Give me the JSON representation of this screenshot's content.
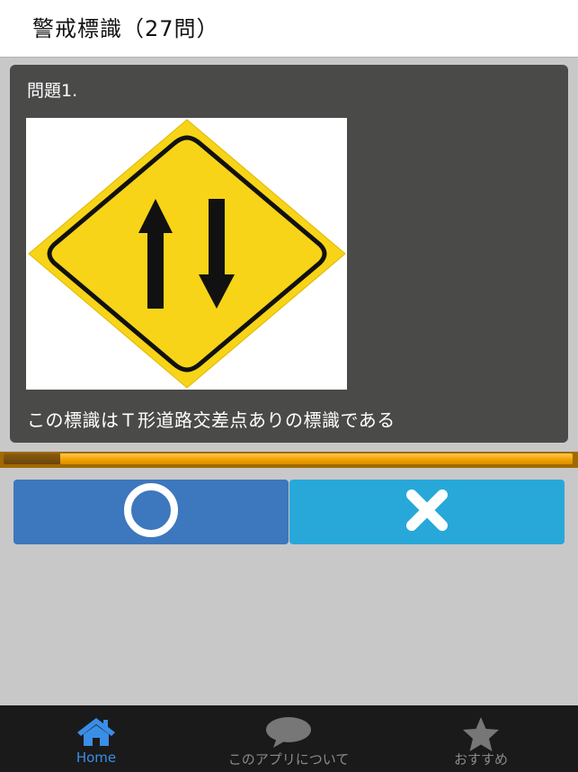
{
  "header": {
    "title": "警戒標識（27問）"
  },
  "question": {
    "number_label": "問題1.",
    "sign_icon": "two-way-traffic-warning-sign",
    "text": "この標識はＴ形道路交差点ありの標識である"
  },
  "progress": {
    "fraction": 0.1
  },
  "answers": {
    "true_icon": "circle-icon",
    "false_icon": "cross-icon"
  },
  "colors": {
    "true_button": "#3d77bd",
    "false_button": "#27a8d9",
    "tab_active": "#3a8ee6",
    "tab_inactive": "#8a8a8a",
    "sign_yellow": "#f7d417"
  },
  "tabs": [
    {
      "label": "Home",
      "icon": "home-icon",
      "active": true
    },
    {
      "label": "このアプリについて",
      "icon": "speech-bubble-icon",
      "active": false
    },
    {
      "label": "おすすめ",
      "icon": "star-icon",
      "active": false
    }
  ]
}
